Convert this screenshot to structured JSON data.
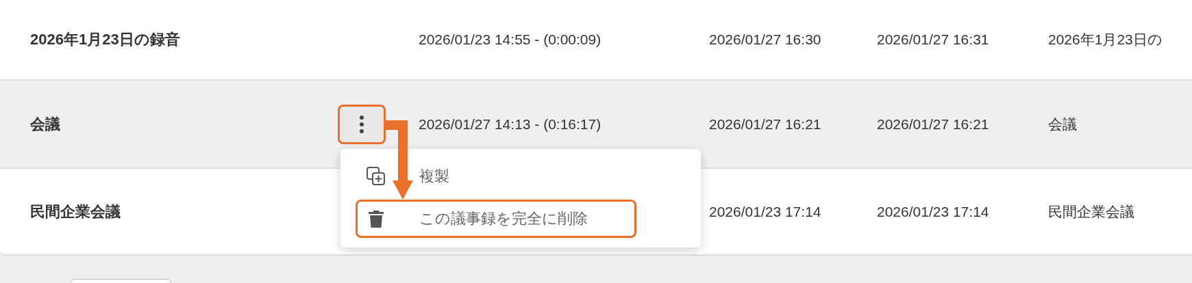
{
  "rows": [
    {
      "name": "2026年1月23日の録音",
      "selected": false,
      "column_2": "2026/01/23 14:55 - (0:00:09)",
      "column_3": "2026/01/27 16:30",
      "column_4": "2026/01/27 16:31",
      "column_5": "2026年1月23日の"
    },
    {
      "name": "会議",
      "selected": true,
      "menu_button": {
        "highlighted": true
      },
      "column_2": "2026/01/27 14:13 - (0:16:17)",
      "column_3": "2026/01/27 16:21",
      "column_4": "2026/01/27 16:21",
      "column_5": "会議"
    },
    {
      "name": "民間企業会議",
      "selected": false,
      "column_3": "2026/01/23 17:14",
      "column_4": "2026/01/23 17:14",
      "column_5": "民間企業会議"
    }
  ],
  "context_menu": {
    "items": [
      {
        "kind": "duplicate",
        "label": "複製",
        "highlighted": false
      },
      {
        "kind": "delete",
        "label": "この議事録を完全に削除",
        "highlighted": true
      }
    ]
  }
}
